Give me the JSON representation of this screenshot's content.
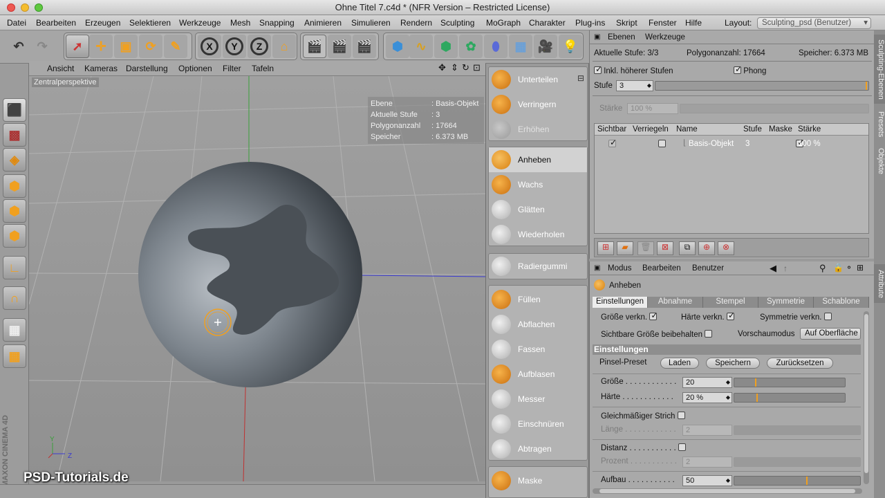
{
  "window": {
    "title": "Ohne Titel 7.c4d * (NFR Version – Restricted License)"
  },
  "menu": {
    "items": [
      "Datei",
      "Bearbeiten",
      "Erzeugen",
      "Selektieren",
      "Werkzeuge",
      "Mesh",
      "Snapping",
      "Animieren",
      "Simulieren",
      "Rendern",
      "Sculpting",
      "MoGraph",
      "Charakter",
      "Plug-ins",
      "Skript",
      "Fenster",
      "Hilfe"
    ],
    "layout_label": "Layout:",
    "layout_value": "Sculpting_psd (Benutzer)"
  },
  "viewport": {
    "menu": [
      "Ansicht",
      "Kameras",
      "Darstellung",
      "Optionen",
      "Filter",
      "Tafeln"
    ],
    "label": "Zentralperspektive",
    "hud": [
      {
        "key": "Ebene",
        "value": ": Basis-Objekt"
      },
      {
        "key": "Aktuelle Stufe",
        "value": ": 3"
      },
      {
        "key": "Polygonanzahl",
        "value": ": 17664"
      },
      {
        "key": "Speicher",
        "value": ": 6.373 MB"
      }
    ],
    "axis_y": "Y",
    "axis_z": "Z"
  },
  "brushes": {
    "group1": [
      "Unterteilen",
      "Verringern",
      "Erhöhen"
    ],
    "group2": [
      "Anheben",
      "Wachs",
      "Glätten",
      "Wiederholen"
    ],
    "group3": [
      "Radiergummi"
    ],
    "group4": [
      "Füllen",
      "Abflachen",
      "Fassen",
      "Aufblasen",
      "Messer",
      "Einschnüren",
      "Abtragen"
    ],
    "group5": [
      "Maske"
    ]
  },
  "layers_panel": {
    "tabs": [
      "Ebenen",
      "Werkzeuge"
    ],
    "info_stage": "Aktuelle Stufe: 3/3",
    "info_poly": "Polygonanzahl: 17664",
    "info_mem": "Speicher: 6.373 MB",
    "opt_higher": "Inkl. höherer Stufen",
    "opt_phong": "Phong",
    "stufe_label": "Stufe",
    "stufe_value": "3",
    "staerke_label": "Stärke",
    "staerke_value": "100 %",
    "columns": [
      "Sichtbar",
      "Verriegeln",
      "Name",
      "Stufe",
      "Maske",
      "Stärke"
    ],
    "row": {
      "name": "Basis-Objekt",
      "stufe": "3",
      "staerke": "100 %"
    }
  },
  "attr_panel": {
    "menu": [
      "Modus",
      "Bearbeiten",
      "Benutzer"
    ],
    "tool_name": "Anheben",
    "tabs": [
      "Einstellungen",
      "Abnahme",
      "Stempel",
      "Symmetrie",
      "Schablone"
    ],
    "row1": {
      "a": "Größe verkn.",
      "b": "Härte verkn.",
      "c": "Symmetrie verkn."
    },
    "row2": {
      "a": "Sichtbare Größe beibehalten",
      "b": "Vorschaumodus",
      "mode": "Auf Oberfläche"
    },
    "section": "Einstellungen",
    "preset_label": "Pinsel-Preset",
    "buttons": [
      "Laden",
      "Speichern",
      "Zurücksetzen"
    ],
    "groesse_label": "Größe . . . . . . . . . . . .",
    "groesse_value": "20",
    "haerte_label": "Härte . . . . . . . . . . . .",
    "haerte_value": "20 %",
    "strich_label": "Gleichmäßiger Strich",
    "laenge_label": "Länge . . . . . . . . . . . .",
    "laenge_value": "2",
    "distanz_label": "Distanz . . . . . . . . . . .",
    "prozent_label": "Prozent . . . . . . . . . . .",
    "prozent_value": "2",
    "aufbau_label": "Aufbau . . . . . . . . . . .",
    "aufbau_value": "50"
  },
  "side_tabs": [
    "Sculpting-Ebenen",
    "Presets",
    "Objekte",
    "Attribute"
  ],
  "watermark": "PSD-Tutorials.de",
  "brand": "MAXON CINEMA 4D",
  "colors": {
    "accent": "#f0a020",
    "active_bg": "#d2d2d2"
  }
}
